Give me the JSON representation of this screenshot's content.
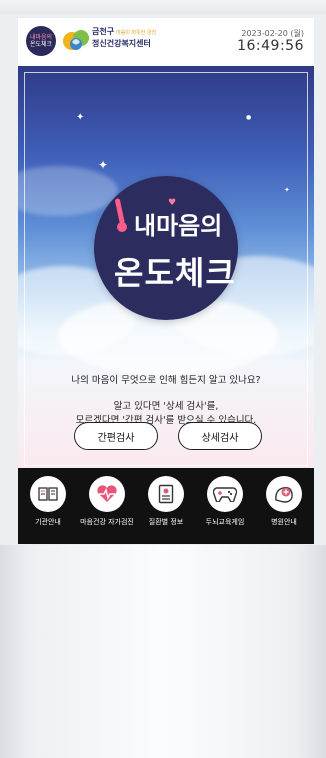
{
  "header": {
    "app_badge_line1": "내마음의",
    "app_badge_line2": "온도체크",
    "org_name_line1": "금천구",
    "org_name_tagline": "마음이 따뜻한 금천",
    "org_name_line2": "정신건강복지센터",
    "date": "2023-02-20 (월)",
    "time": "16:49:56"
  },
  "hero": {
    "emblem_line1": "내마음의",
    "emblem_line2": "온도체크",
    "question": "나의 마음이 무엇으로 인해 힘든지 알고 있나요?",
    "explain_line1": "알고 있다면 '상세 검사'를,",
    "explain_line2": "모르겠다면 '간편 검사'를 받으실 수 있습니다.",
    "buttons": {
      "simple": "간편검사",
      "detail": "상세검사"
    }
  },
  "menu": {
    "items": [
      {
        "label": "기관안내",
        "icon": "book-icon"
      },
      {
        "label": "마음건강 자가검진",
        "icon": "heart-pulse-icon"
      },
      {
        "label": "질환별 정보",
        "icon": "document-icon"
      },
      {
        "label": "두뇌교육게임",
        "icon": "gamepad-icon"
      },
      {
        "label": "병원안내",
        "icon": "hospital-icon"
      }
    ]
  },
  "colors": {
    "emblem_bg": "#2d2c5e",
    "accent_pink": "#ff5c8a",
    "menu_bg": "#111111"
  }
}
